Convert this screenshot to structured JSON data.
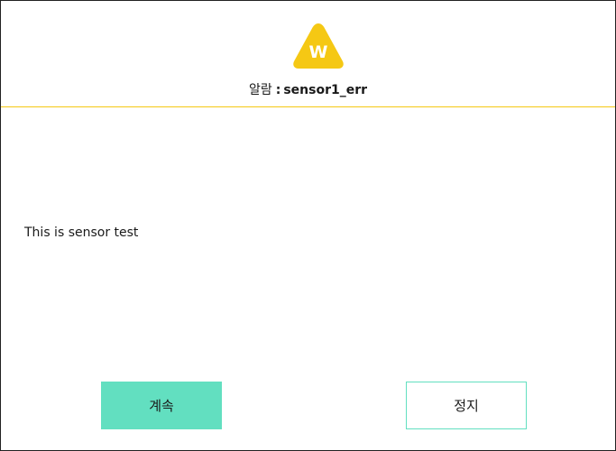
{
  "dialog": {
    "icon": {
      "name": "warning-triangle-icon",
      "letter": "W",
      "color": "#f5c814"
    },
    "title": {
      "prefix": "알람",
      "separator": ":",
      "alarm_name": "sensor1_err"
    },
    "message": "This is sensor test",
    "buttons": {
      "continue_label": "계속",
      "stop_label": "정지"
    },
    "colors": {
      "accent": "#62dfc0",
      "header_divider": "#f5c814",
      "border": "#222222"
    }
  }
}
